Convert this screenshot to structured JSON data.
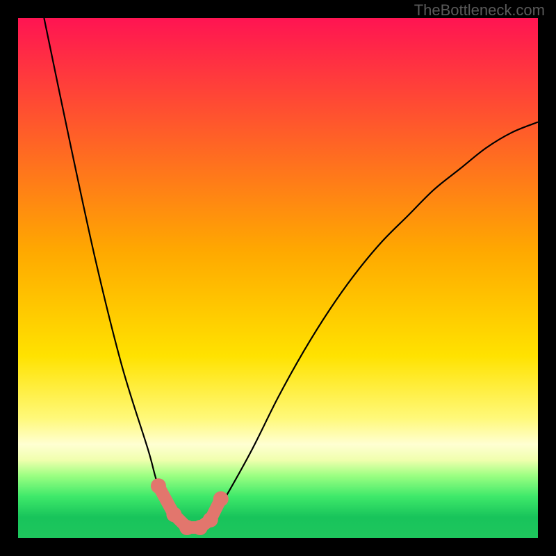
{
  "watermark": "TheBottleneck.com",
  "chart_data": {
    "type": "line",
    "title": "",
    "xlabel": "",
    "ylabel": "",
    "ylim": [
      0,
      100
    ],
    "xlim": [
      0,
      100
    ],
    "series": [
      {
        "name": "bottleneck-curve",
        "x": [
          5,
          10,
          15,
          20,
          25,
          27,
          30,
          32.5,
          35,
          37.5,
          40,
          45,
          50,
          55,
          60,
          65,
          70,
          75,
          80,
          85,
          90,
          95,
          100
        ],
        "values": [
          100,
          76,
          53,
          33,
          17,
          10,
          4.5,
          2,
          2,
          4,
          8,
          17,
          27,
          36,
          44,
          51,
          57,
          62,
          67,
          71,
          75,
          78,
          80
        ]
      }
    ],
    "markers": {
      "name": "highlighted-points",
      "x": [
        27,
        30,
        32.5,
        35,
        37,
        39
      ],
      "values": [
        10,
        4.5,
        2,
        2,
        3.5,
        7.5
      ]
    },
    "colors": {
      "curve": "#000000",
      "marker_fill": "#e2766d",
      "marker_stroke": "#e2766d",
      "gradient_top": "#ff1452",
      "gradient_bottom": "#1ec65d"
    }
  }
}
